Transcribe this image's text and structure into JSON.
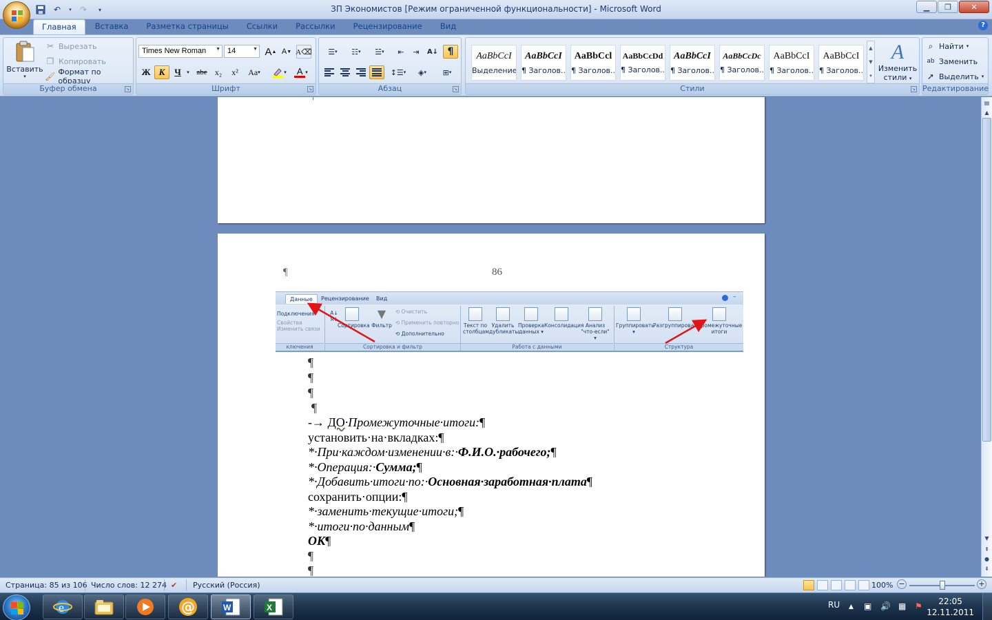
{
  "window": {
    "title": "ЗП Экономистов [Режим ограниченной функциональности] - Microsoft Word"
  },
  "tabs": [
    "Главная",
    "Вставка",
    "Разметка страницы",
    "Ссылки",
    "Рассылки",
    "Рецензирование",
    "Вид"
  ],
  "active_tab": "Главная",
  "clipboard": {
    "paste": "Вставить",
    "cut": "Вырезать",
    "copy": "Копировать",
    "format_painter": "Формат по образцу",
    "label": "Буфер обмена"
  },
  "font": {
    "name": "Times New Roman",
    "size": "14",
    "bold": "Ж",
    "italic": "К",
    "underline": "Ч",
    "strike": "abe",
    "subscript": "x₂",
    "superscript": "x²",
    "change_case": "Aa",
    "grow": "A",
    "shrink": "A",
    "label": "Шрифт",
    "highlight_color": "#ffff00",
    "font_color": "#e00000"
  },
  "paragraph": {
    "label": "Абзац",
    "pilcrow": "¶"
  },
  "styles": {
    "label": "Стили",
    "items": [
      {
        "sample": "AaBbCcI",
        "name": "Выделение"
      },
      {
        "sample": "AaBbCcI",
        "name": "¶ Заголов..."
      },
      {
        "sample": "AaBbCcl",
        "name": "¶ Заголов..."
      },
      {
        "sample": "AaBbCcDd",
        "name": "¶ Заголов..."
      },
      {
        "sample": "AaBbCcI",
        "name": "¶ Заголов..."
      },
      {
        "sample": "AaBbCcDc",
        "name": "¶ Заголов..."
      },
      {
        "sample": "AaBbCcI",
        "name": "¶ Заголов..."
      },
      {
        "sample": "AaBbCcI",
        "name": "¶ Заголов..."
      }
    ],
    "change_styles_line1": "Изменить",
    "change_styles_line2": "стили"
  },
  "editing": {
    "find": "Найти",
    "replace": "Заменить",
    "select": "Выделить",
    "label": "Редактирование"
  },
  "document": {
    "page_number": "86",
    "header_pilcrow": "¶",
    "embedded": {
      "tabs": [
        "Данные",
        "Рецензирование",
        "Вид"
      ],
      "connections": {
        "items": [
          "Подключения",
          "Свойства",
          "Изменить связи"
        ],
        "label": "ключения"
      },
      "sort_filter": {
        "sort": "Сортировка",
        "filter": "Фильтр",
        "clear": "Очистить",
        "reapply": "Применить повторно",
        "advanced": "Дополнительно",
        "label": "Сортировка и фильтр"
      },
      "data_tools": {
        "text_to_columns_1": "Текст по",
        "text_to_columns_2": "столбцам",
        "remove_dup_1": "Удалить",
        "remove_dup_2": "дубликаты",
        "validation_1": "Проверка",
        "validation_2": "данных",
        "consolidate": "Консолидация",
        "whatif_1": "Анализ",
        "whatif_2": "\"что-если\"",
        "label": "Работа с данными"
      },
      "outline": {
        "group": "Группировать",
        "ungroup": "Разгруппировать",
        "subtotal_1": "Промежуточные",
        "subtotal_2": "итоги",
        "label": "Структура"
      }
    },
    "lines": {
      "l1": "¶",
      "l2": "¶",
      "l3": "¶",
      "l4": "¶",
      "l5_arrow": "-→ ",
      "l5_a": "ДО",
      "l5_b": "·Промежуточные·итоги:",
      "l5_pm": "¶",
      "l6": "установить·на·вкладках:¶",
      "l7_a": "*·При·каждом·изменении·в:·",
      "l7_b": "Ф.И.О.·рабочего;",
      "l7_pm": "¶",
      "l8_a": "*·Операция:·",
      "l8_b": "Сумма;",
      "l8_pm": "¶",
      "l9_a": "*·Добавить·итоги·по:·",
      "l9_b": "Основная·заработная·плата",
      "l9_pm": "¶",
      "l10": "сохранить·опции:¶",
      "l11": "*·заменить·текущие·итоги;",
      "l11_pm": "¶",
      "l12": "*·итоги·по·данным",
      "l12_pm": "¶",
      "l13": "ОК",
      "l13_pm": "¶",
      "l14": "¶",
      "l15": "¶"
    }
  },
  "status": {
    "page": "Страница: 85 из 106",
    "words": "Число слов: 12 274",
    "language": "Русский (Россия)",
    "zoom": "100%",
    "zoom_minus": "−",
    "zoom_plus": "+"
  },
  "taskbar": {
    "lang": "RU",
    "time": "22:05",
    "date": "12.11.2011"
  }
}
